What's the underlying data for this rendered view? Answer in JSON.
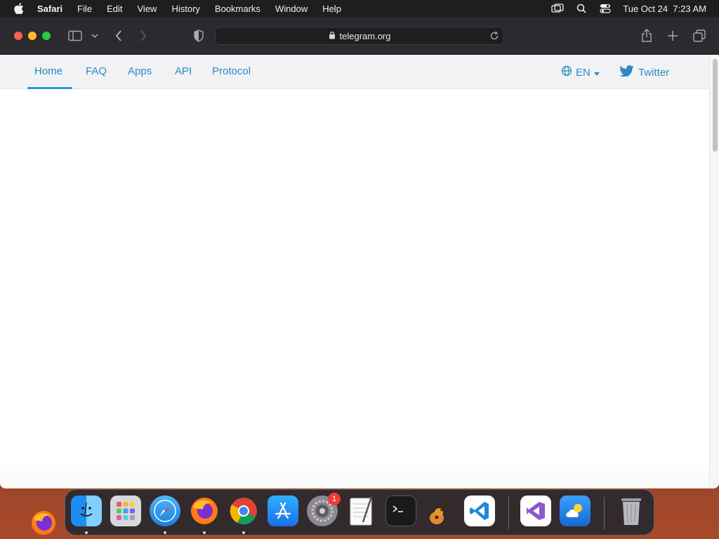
{
  "menubar": {
    "app_name": "Safari",
    "items": [
      "File",
      "Edit",
      "View",
      "History",
      "Bookmarks",
      "Window",
      "Help"
    ],
    "datetime": "Tue Oct 24  7:23 AM"
  },
  "browser": {
    "url": "telegram.org"
  },
  "site_nav": {
    "links": [
      "Home",
      "FAQ",
      "Apps",
      "API",
      "Protocol"
    ],
    "active": "Home",
    "language": "EN",
    "twitter": "Twitter"
  },
  "dock": {
    "apps": [
      "Finder",
      "Launchpad",
      "Safari",
      "Firefox",
      "Chrome",
      "App Store",
      "System Preferences",
      "TextEdit",
      "Terminal",
      "GarageBand",
      "Visual Studio Code",
      "Visual Studio",
      "Weather",
      "Trash"
    ],
    "system_prefs_badge": "1"
  },
  "colors": {
    "link": "#2a8bc4",
    "nav_bg": "#f1f2f4",
    "toolbar_bg": "#2b2a2e",
    "menubar_bg": "#1e1e1e"
  }
}
